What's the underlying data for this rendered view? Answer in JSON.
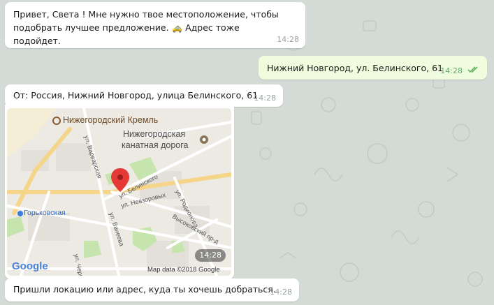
{
  "messages": [
    {
      "text": "Привет, Света ! Мне нужно твое местоположение, чтобы подобрать лучшее предложение. 🚕 Адрес тоже подойдет.",
      "time": "14:28",
      "direction": "in"
    },
    {
      "text": "Нижний Новгород, ул. Белинского, 61",
      "time": "14:28",
      "direction": "out",
      "status": "read"
    },
    {
      "text": "От: Россия, Нижний Новгород, улица Белинского, 61",
      "time": "14:28",
      "direction": "in"
    },
    {
      "type": "location",
      "time": "14:28"
    },
    {
      "text": "Пришли локацию или адрес, куда ты хочешь добраться.",
      "time": "14:28",
      "direction": "in"
    }
  ],
  "map": {
    "labels": {
      "kremlin": "Нижегородский Кремль",
      "cableway_1": "Нижегородская",
      "cableway_2": "канатная дорога",
      "varvarskaya": "ул. Варварская",
      "belinskogo": "ул. Белинского",
      "nevzorovykh": "ул. Невзоровых",
      "gorkovskaya": "Горьковская",
      "vaneeva": "ул. Ванеева",
      "rodionova": "ул. Родионова",
      "vysokovsky": "Высоковский пр-д",
      "chernigovskaya": "ул. Чернигов",
      "google": "Google",
      "attribution": "Map data ©2018 Google"
    },
    "colors": {
      "pin": "#e53935",
      "park": "#c6e4ad",
      "road": "#ffffff",
      "major_road": "#f5d58a"
    }
  },
  "colors": {
    "wallpaper": "#d4dad6",
    "incoming": "#ffffff",
    "outgoing": "#effdde",
    "read_check": "#5fb35f"
  }
}
